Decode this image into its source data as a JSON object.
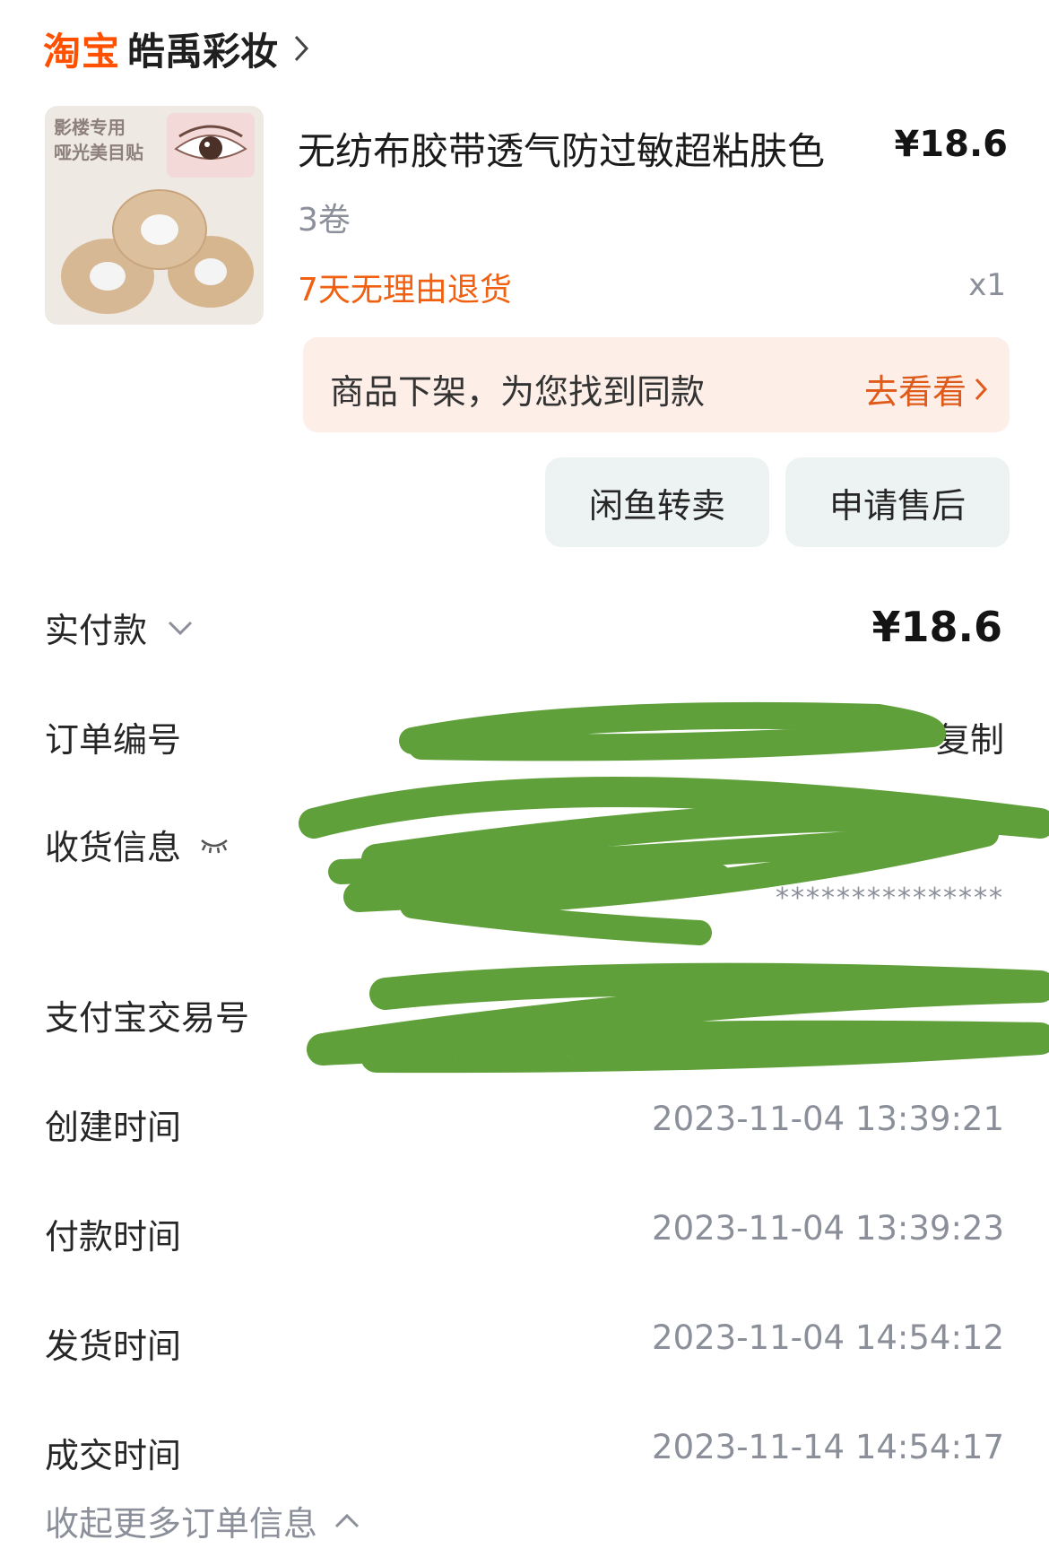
{
  "header": {
    "brand": "淘宝",
    "shop_name": "皓禹彩妆"
  },
  "product": {
    "thumb_text": [
      "影楼专用",
      "哑光美目贴"
    ],
    "title": "无纺布胶带透气防过敏超粘肤色",
    "price": "¥18.6",
    "spec": "3卷",
    "return_policy": "7天无理由退货",
    "quantity": "x1"
  },
  "notice": {
    "text": "商品下架，为您找到同款",
    "link": "去看看"
  },
  "actions": {
    "resell": "闲鱼转卖",
    "after_sale": "申请售后"
  },
  "details": {
    "paid_label": "实付款",
    "paid_amount": "¥18.6",
    "order_no_label": "订单编号",
    "copy": "复制",
    "shipping_label": "收货信息",
    "shipping_masked": "***************",
    "alipay_label": "支付宝交易号",
    "created_label": "创建时间",
    "created_value": "2023-11-04 13:39:21",
    "paid_time_label": "付款时间",
    "paid_time_value": "2023-11-04 13:39:23",
    "shipped_label": "发货时间",
    "shipped_value": "2023-11-04 14:54:12",
    "completed_label": "成交时间",
    "completed_value": "2023-11-14 14:54:17",
    "collapse": "收起更多订单信息"
  },
  "colors": {
    "accent": "#ff5000",
    "redaction": "#5fa03a",
    "notice_bg": "#fdeee7"
  }
}
